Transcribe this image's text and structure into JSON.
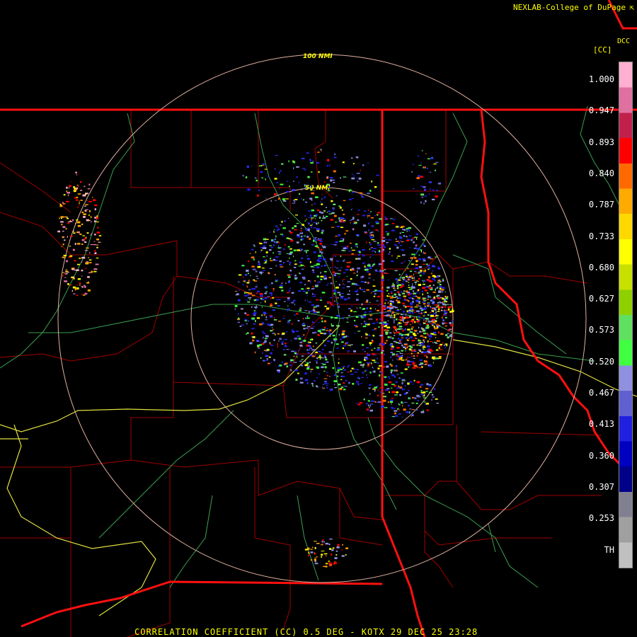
{
  "header": {
    "credit": "NEXLAB-College of DuPage",
    "credit_icon": "external-link-icon",
    "dcc": "DCC"
  },
  "legend": {
    "unit": "[CC]",
    "ticks": [
      "1.000",
      "0.947",
      "0.893",
      "0.840",
      "0.787",
      "0.733",
      "0.680",
      "0.627",
      "0.573",
      "0.520",
      "0.467",
      "0.413",
      "0.360",
      "0.307",
      "0.253",
      "TH"
    ],
    "colors": [
      "#ffb0d0",
      "#e070a0",
      "#c0204a",
      "#ff0000",
      "#ff6a00",
      "#ffaa00",
      "#ffd800",
      "#ffff00",
      "#c8e000",
      "#8ed000",
      "#60e060",
      "#40ff40",
      "#9090e0",
      "#6060d0",
      "#2020e0",
      "#0000c0",
      "#000088",
      "#808090",
      "#a0a0a0",
      "#c0c0c0"
    ]
  },
  "map": {
    "ring_labels": [
      "100 NMI",
      "50 NMI"
    ]
  },
  "footer": {
    "text": "CORRELATION COEFFICIENT (CC) 0.5 DEG - KOTX 29 DEC 25 23:28"
  }
}
